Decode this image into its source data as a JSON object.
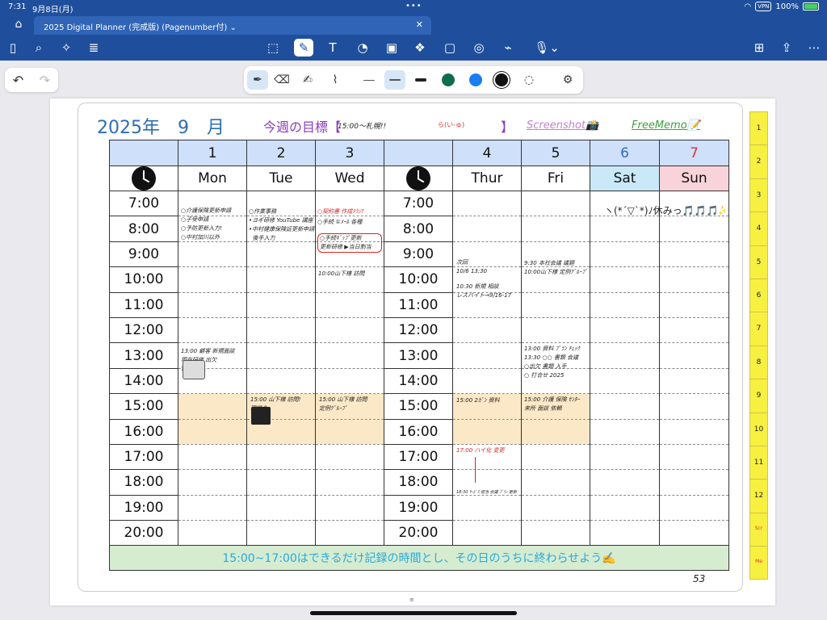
{
  "status": {
    "time": "7:31",
    "date": "9月8日(月)",
    "vpn": "VPN",
    "battery": "100%",
    "battery_fill": 1.0
  },
  "tab": {
    "title": "2025 Digital Planner (完成版) (Pagenumber付) ⌄"
  },
  "toolbar_icons": [
    "sidebar-icon",
    "search-icon",
    "sparkle-icon",
    "export-icon",
    "lasso-icon",
    "pen-icon",
    "text-icon",
    "shapes-icon",
    "image-icon",
    "elements-icon",
    "sticky-note-icon",
    "record-icon",
    "laser-icon",
    "mic-icon",
    "add-page-icon",
    "share-icon",
    "more-icon"
  ],
  "planner": {
    "year_month": "2025年　9　月",
    "goal_label": "今週の目標【",
    "goal_hand": "15:00～札幌!!",
    "goal_hand2": "ら(い-ゅ)",
    "goal_close": "】",
    "screenshot_link": "Screenshot📸",
    "freememo_link": "FreeMemo📝",
    "page_number": "53",
    "date_numbers": [
      "1",
      "2",
      "3",
      "4",
      "5",
      "6",
      "7"
    ],
    "days": [
      "Mon",
      "Tue",
      "Wed",
      "Thur",
      "Fri",
      "Sat",
      "Sun"
    ],
    "times": [
      "7:00",
      "8:00",
      "9:00",
      "10:00",
      "11:00",
      "12:00",
      "13:00",
      "14:00",
      "15:00",
      "16:00",
      "17:00",
      "18:00",
      "19:00",
      "20:00"
    ],
    "banner": "15:00~17:00はできるだけ記録の時間とし、その日のうちに終わらせよう✍️",
    "notes": {
      "mon_am": "○介護保険更新申請\n○子受申請\n○予防更新入力!\n○中村加川以外",
      "tue_am": "○作業事務\n•ヨギ研修 YouTube 講座\n•中村健康保険証更新申請\n  後手入力",
      "wed_am1": "○契約書 作成ﾁﾗｼ?",
      "wed_am2": "○手続 ①ﾒｰﾙ 各種",
      "wed_am3": "○手続ｷﾞｯﾌﾟ更新\n更新研修 ▶当日割当",
      "wed_10": "10:00山下様 訪問",
      "mon_13": "13:00 顧客 新規面談\n現在研修 出欠\nTuLK",
      "fri_13": "13:00 資料 ﾌﾟﾗﾝ ﾁｪｯｸ\n13:30 ○○ 書類 会議\n○出欠 書類 入手\n○ 打合せ 2025",
      "thu_9": "次回\n10/6 13:30",
      "thu_10": "10:30 新規 相談\nレスパイト→9/16-17",
      "fri_9": "9:30 本社会議 議題\n10:00山下様 定例ｸﾞﾙｰﾌﾟ",
      "tue_15": "15:00 山下様 訪問!\n現場会",
      "wed_15": "15:00 山下様 訪問\n定例ｸﾞﾙｰﾌﾟ",
      "thu_15": "15:00 2ｶﾞﾝ 資料",
      "fri_15": "15:00 介護 保険 ｾﾝﾀｰ\n来所 面談 依頼",
      "thu_17": "17:00 ハイ化 変更",
      "thu_18": "18:30 ｻｰﾋﾞｽ 担当 会議 ﾌﾟﾗﾝ 更新",
      "sat_7": "ヽ(*´▽`*)ﾉ休みっ🎵🎵🎵✨"
    },
    "index_tabs": [
      "1",
      "2",
      "3",
      "4",
      "5",
      "6",
      "7",
      "8",
      "9",
      "10",
      "11",
      "12",
      "Scr",
      "Me"
    ]
  }
}
